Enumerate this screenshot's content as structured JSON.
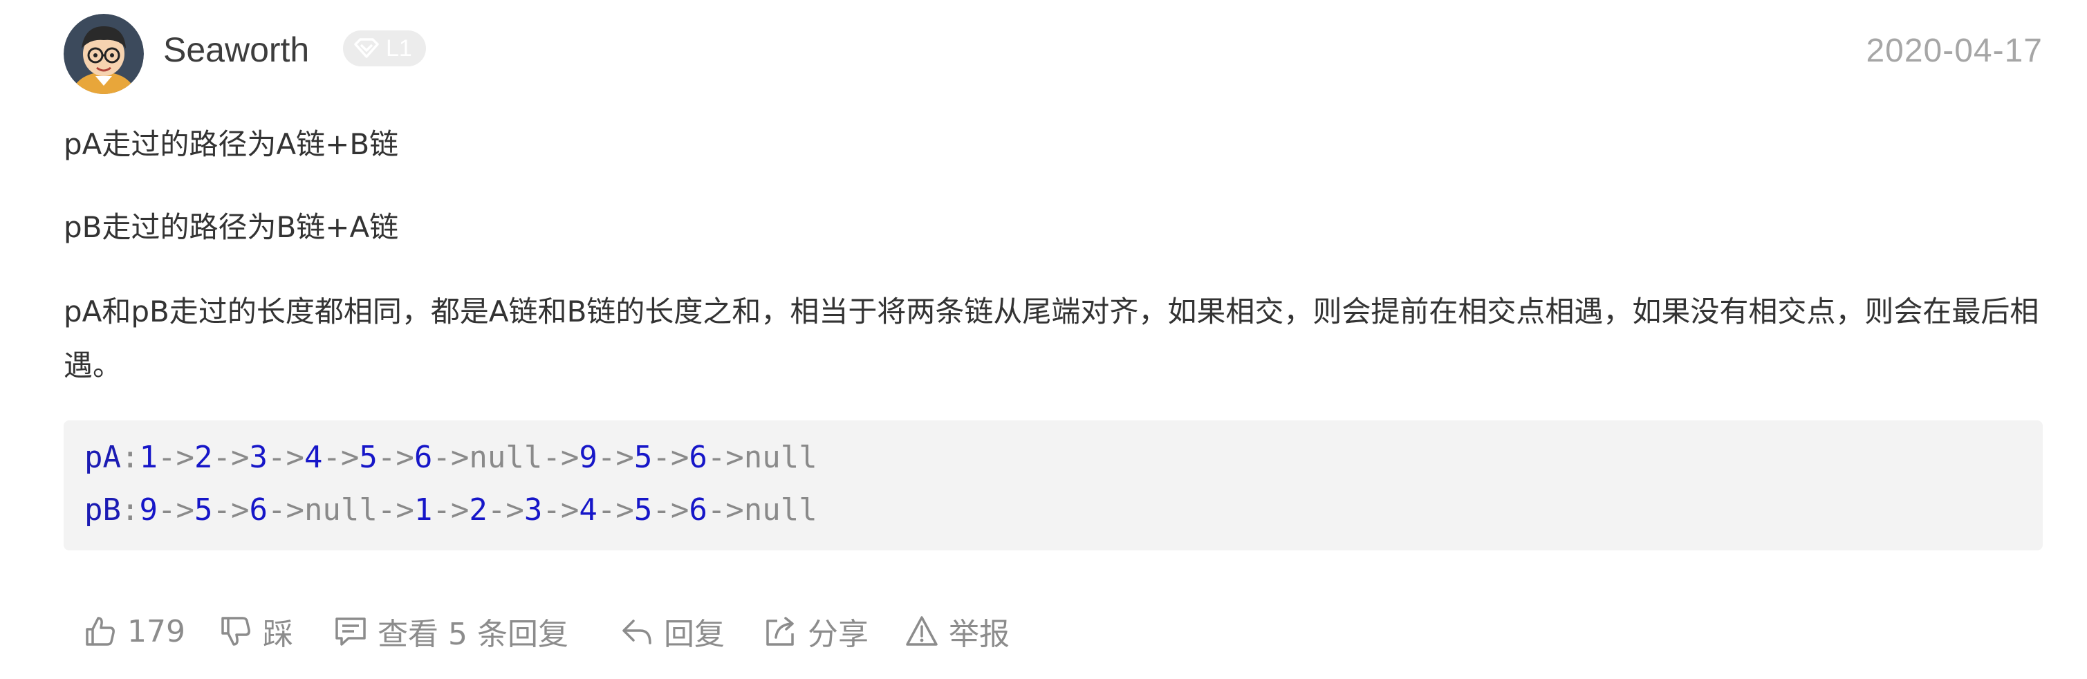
{
  "comment": {
    "author": "Seaworth",
    "level": "L1",
    "date": "2020-04-17",
    "paragraphs": [
      "pA走过的路径为A链+B链",
      "pB走过的路径为B链+A链",
      "pA和pB走过的长度都相同，都是A链和B链的长度之和，相当于将两条链从尾端对齐，如果相交，则会提前在相交点相遇，如果没有相交点，则会在最后相遇。"
    ],
    "code_lines": [
      "pA:1->2->3->4->5->6->null->9->5->6->null",
      "pB:9->5->6->null->1->2->3->4->5->6->null"
    ]
  },
  "actions": {
    "like_count": "179",
    "dislike_label": "踩",
    "view_replies_label": "查看 5 条回复",
    "reply_label": "回复",
    "share_label": "分享",
    "report_label": "举报"
  },
  "icons": {
    "avatar": "avatar",
    "level": "diamond-icon",
    "like": "thumbs-up-icon",
    "dislike": "thumbs-down-icon",
    "view_replies": "comment-icon",
    "reply": "reply-arrow-icon",
    "share": "share-icon",
    "report": "warning-icon"
  },
  "colors": {
    "code_keyword": "#1b1bb3",
    "code_number": "#1616c8",
    "code_background": "#f3f3f3",
    "muted_text": "#8c8c8c"
  }
}
